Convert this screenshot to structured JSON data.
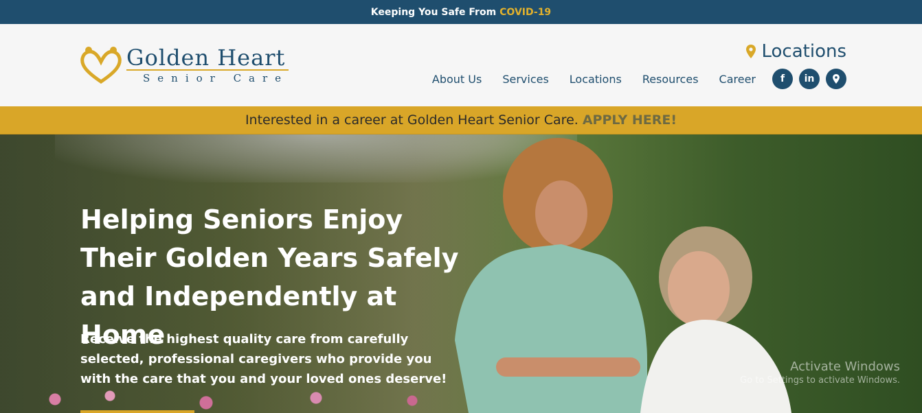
{
  "top_bar": {
    "text": "Keeping You Safe From",
    "highlight": "COVID-19"
  },
  "logo": {
    "main": "Golden Heart",
    "sub": "Senior Care"
  },
  "header": {
    "locations_label": "Locations",
    "nav": [
      "About Us",
      "Services",
      "Locations",
      "Resources",
      "Career"
    ],
    "social": [
      {
        "icon": "facebook-icon",
        "glyph": "f"
      },
      {
        "icon": "linkedin-icon",
        "glyph": "in"
      },
      {
        "icon": "map-pin-icon",
        "glyph": ""
      }
    ]
  },
  "career_bar": {
    "text": "Interested in a career at Golden Heart Senior Care.",
    "apply": "APPLY HERE!"
  },
  "hero": {
    "headline": "Helping Seniors Enjoy Their Golden Years Safely and Independently at Home",
    "body": "Receive the highest quality care from carefully selected, professional caregivers who provide you with the care that you and your loved ones deserve!"
  },
  "watermark": {
    "line1": "Activate Windows",
    "line2": "Go to Settings to activate Windows."
  },
  "colors": {
    "navy": "#1f4e6e",
    "gold": "#d9a628"
  }
}
